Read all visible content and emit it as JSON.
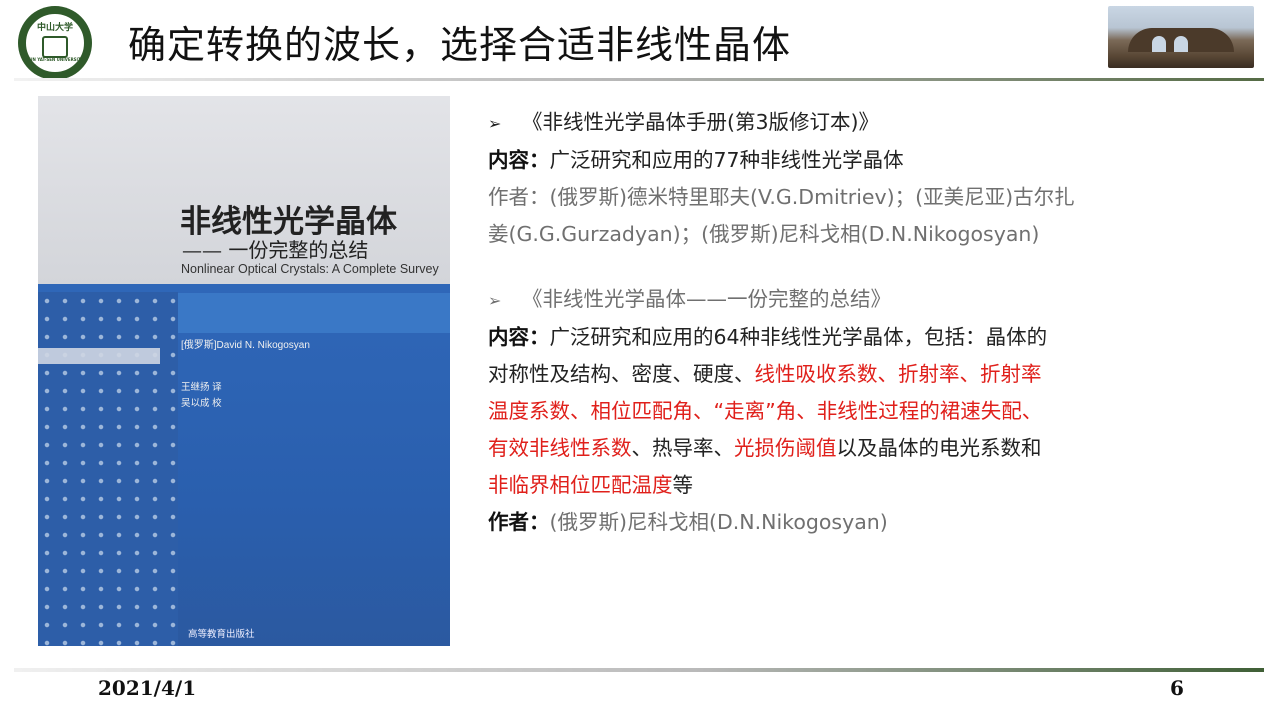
{
  "header": {
    "title": "确定转换的波长，选择合适非线性晶体",
    "logo_text_top": "中山大学",
    "logo_text_bottom": "SUN YAT-SEN UNIVERSITY"
  },
  "book_cover": {
    "title_cn": "非线性光学晶体",
    "subtitle_cn": "—— 一份完整的总结",
    "title_en": "Nonlinear Optical Crystals: A Complete Survey",
    "author": "[俄罗斯]David N. Nikogosyan",
    "translator": "王继扬 译",
    "proofreader": "吴以成 校",
    "publisher": "高等教育出版社"
  },
  "entries": [
    {
      "bullet": "➢",
      "book_title": "《非线性光学晶体手册(第3版修订本)》",
      "content_label": "内容：",
      "content_text": "广泛研究和应用的77种非线性光学晶体",
      "author_label": "作者：",
      "author_line1": "(俄罗斯)德米特里耶夫(V.G.Dmitriev)；(亚美尼亚)古尔扎",
      "author_line2": "姜(G.G.Gurzadyan)；(俄罗斯)尼科戈相(D.N.Nikogosyan)"
    },
    {
      "bullet": "➢",
      "book_title": "《非线性光学晶体——一份完整的总结》",
      "content_label": "内容：",
      "content_l1": "广泛研究和应用的64种非线性光学晶体，包括：晶体的",
      "content_l2a": "对称性及结构、密度、硬度、",
      "content_l2b": "线性吸收系数、折射率、折射率",
      "content_l3": "温度系数、相位匹配角、“走离”角、非线性过程的裙速失配、",
      "content_l4a": "有效非线性系数",
      "content_l4b": "、热导率、",
      "content_l4c": "光损伤阈值",
      "content_l4d": "以及晶体的电光系数和",
      "content_l5a": "非临界相位匹配温度",
      "content_l5b": "等",
      "author_label": "作者：",
      "author_text": "(俄罗斯)尼科戈相(D.N.Nikogosyan)"
    }
  ],
  "footer": {
    "date": "2021/4/1",
    "page": "6"
  },
  "colors": {
    "accent_red": "#e0201b",
    "gray_text": "#707070",
    "brand_green": "#2f5a2a",
    "cover_blue": "#2a5fae"
  }
}
